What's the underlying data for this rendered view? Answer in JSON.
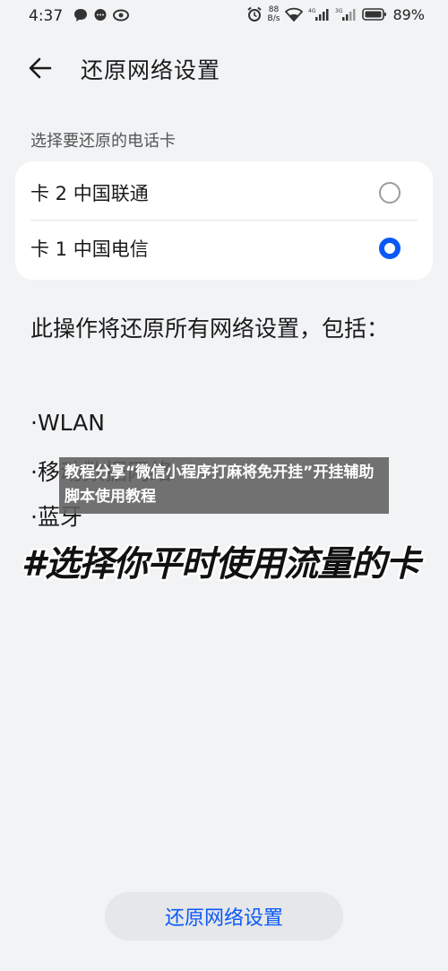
{
  "status_bar": {
    "time": "4:37",
    "net_speed_value": "88",
    "net_speed_unit": "B/s",
    "battery": "89%",
    "icons": [
      "chat-bubble-icon",
      "message-icon",
      "eye-icon",
      "alarm-icon",
      "wifi-icon",
      "signal-4g-icon",
      "signal-3g-icon",
      "battery-icon"
    ]
  },
  "header": {
    "title": "还原网络设置"
  },
  "sim_section": {
    "label": "选择要还原的电话卡",
    "options": [
      {
        "label": "卡 2 中国联通",
        "selected": false
      },
      {
        "label": "卡 1 中国电信",
        "selected": true
      }
    ]
  },
  "description": "此操作将还原所有网络设置，包括：",
  "bullets": [
    "·WLAN",
    "·移动数据网络",
    "·蓝牙"
  ],
  "overlay": {
    "text": "教程分享“微信小程序打麻将免开挂”开挂辅助脚本使用教程"
  },
  "caption": "#选择你平时使用流量的卡",
  "footer": {
    "button_label": "还原网络设置"
  },
  "colors": {
    "accent": "#0a59f7",
    "background": "#f1f3f5",
    "card": "#ffffff"
  }
}
